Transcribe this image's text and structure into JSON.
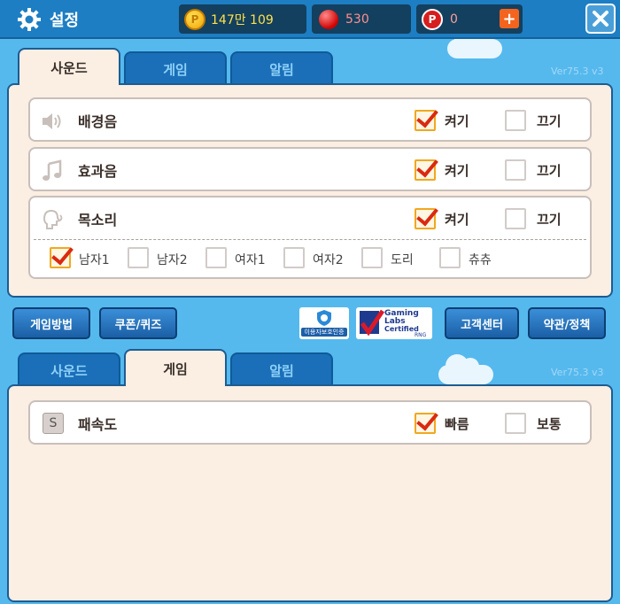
{
  "header": {
    "title": "설정",
    "gold": "147만 109",
    "ruby": "530",
    "point": "0",
    "coin_glyph": "P",
    "point_glyph": "P"
  },
  "tabs_top": [
    "사운드",
    "게임",
    "알림"
  ],
  "tabs_bottom": [
    "사운드",
    "게임",
    "알림"
  ],
  "version": "Ver75.3 v3",
  "version_bottom": "Ver75.3 v3",
  "sound": {
    "rows": [
      {
        "label": "배경음",
        "on": "켜기",
        "off": "끄기",
        "icon": "speaker-icon"
      },
      {
        "label": "효과음",
        "on": "켜기",
        "off": "끄기",
        "icon": "music-note-icon"
      },
      {
        "label": "목소리",
        "on": "켜기",
        "off": "끄기",
        "icon": "voice-head-icon"
      }
    ],
    "voices": [
      "남자1",
      "남자2",
      "여자1",
      "여자2",
      "도리",
      "츄츄"
    ]
  },
  "buttons": {
    "guide": "게임방법",
    "coupon": "쿠폰/퀴즈",
    "support": "고객센터",
    "terms": "약관/정책"
  },
  "badges": {
    "protection": "이용자보호인증",
    "gli_line1": "Gaming",
    "gli_line2": "Labs",
    "gli_line3": "Certified",
    "gli_line4": "RNG"
  },
  "game": {
    "row_label": "패속도",
    "fast": "빠름",
    "normal": "보통",
    "icon_glyph": "S"
  },
  "colors": {
    "accent_check": "#d92a10",
    "topbar": "#1d7ec3",
    "panel": "#fbeee2"
  }
}
